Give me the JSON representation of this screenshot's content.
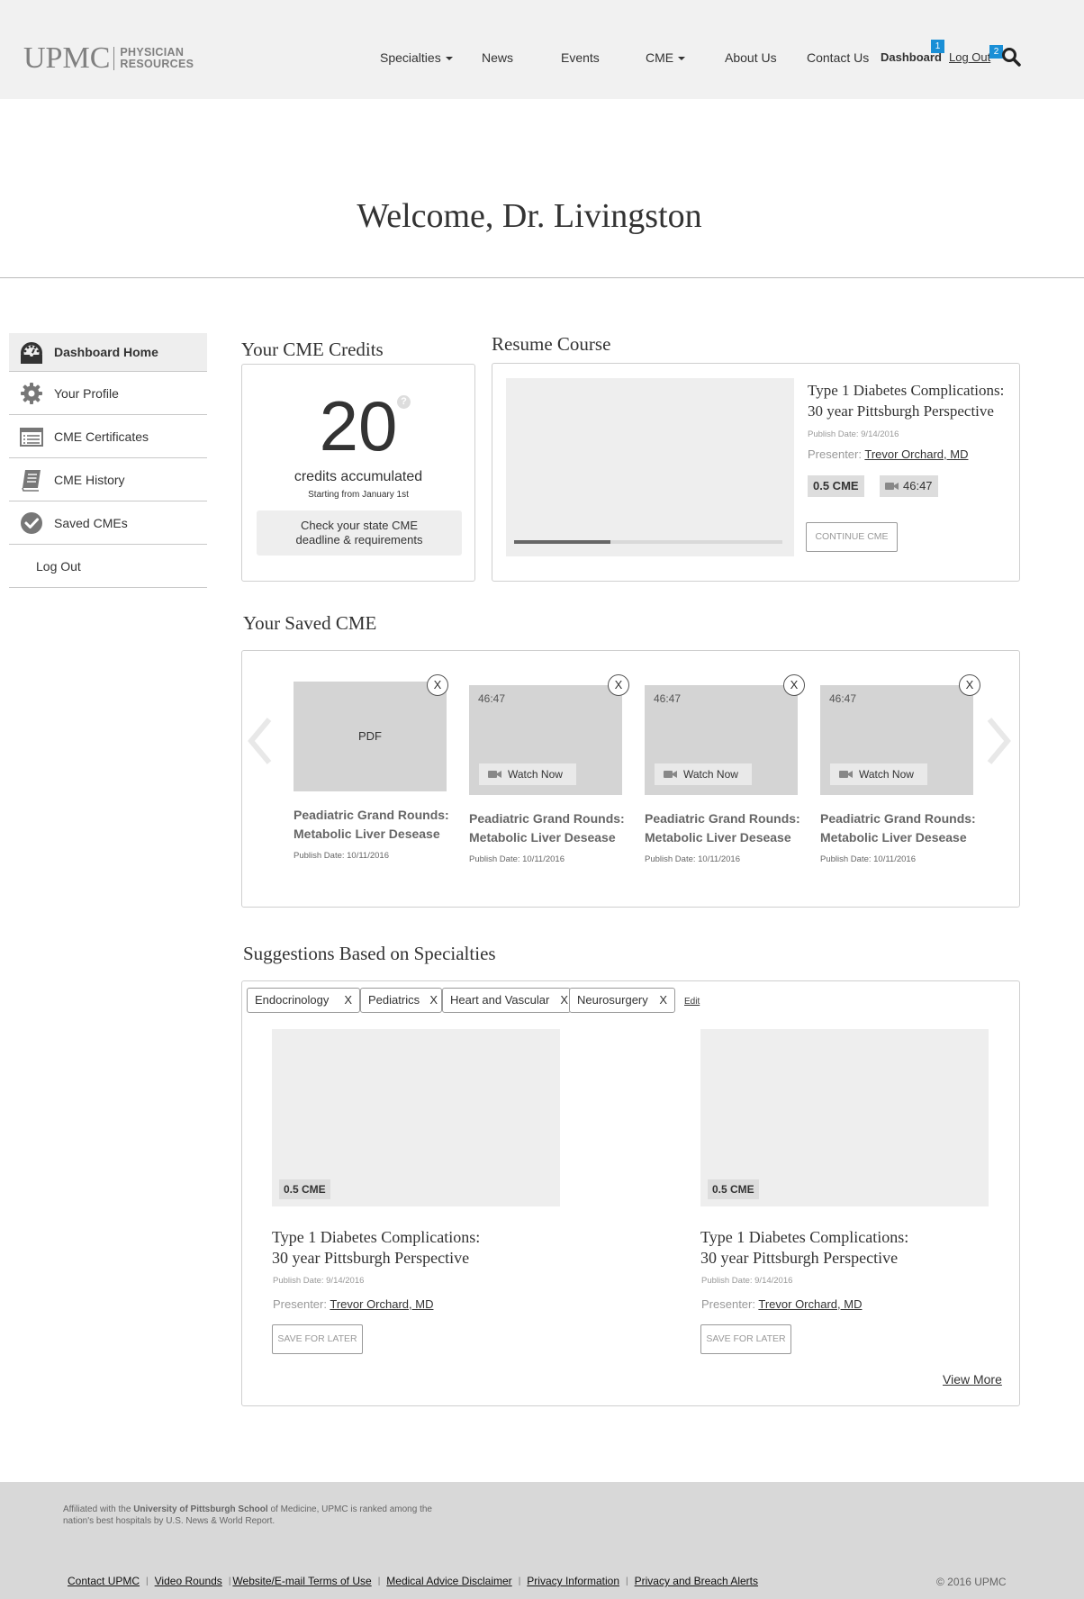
{
  "header": {
    "logo_main": "UPMC",
    "logo_sub_line1": "PHYSICIAN",
    "logo_sub_line2": "RESOURCES",
    "nav": [
      {
        "label": "Specialties"
      },
      {
        "label": "News"
      },
      {
        "label": "Events"
      },
      {
        "label": "CME"
      },
      {
        "label": "About Us"
      },
      {
        "label": "Contact Us"
      },
      {
        "label": "Dashboard",
        "badge": "1"
      },
      {
        "label": "Log Out",
        "badge": "2"
      }
    ]
  },
  "welcome": "Welcome, Dr. Livingston",
  "sidebar": {
    "items": [
      {
        "label": "Dashboard Home",
        "icon": "dashboard-gauge-icon"
      },
      {
        "label": "Your Profile",
        "icon": "gear-icon"
      },
      {
        "label": "CME Certificates",
        "icon": "certificate-list-icon"
      },
      {
        "label": "CME History",
        "icon": "book-icon"
      },
      {
        "label": "Saved CMEs",
        "icon": "checkmark-circle-icon"
      },
      {
        "label": "Log Out"
      }
    ]
  },
  "credits": {
    "title": "Your CME Credits",
    "value": "20",
    "help_glyph": "?",
    "label": "credits accumulated",
    "sub": "Starting from January 1st",
    "check_line1": "Check your state CME",
    "check_line2": "deadline & requirements"
  },
  "resume": {
    "title": "Resume Course",
    "course_line1": "Type 1 Diabetes Complications:",
    "course_line2": "30 year Pittsburgh Perspective",
    "publish_date": "Publish Date: 9/14/2016",
    "presenter_label": "Presenter:",
    "presenter_name": "Trevor Orchard, MD",
    "cme": "0.5 CME",
    "duration": "46:47",
    "progress": 0.36,
    "continue_label": "CONTINUE CME"
  },
  "saved": {
    "title": "Your Saved CME",
    "close_glyph": "X",
    "watch_label": "Watch Now",
    "items": [
      {
        "type": "PDF",
        "title_line1": "Peadiatric Grand Rounds:",
        "title_line2": "Metabolic Liver Desease",
        "date": "Publish Date: 10/11/2016"
      },
      {
        "duration": "46:47",
        "title_line1": "Peadiatric Grand Rounds:",
        "title_line2": "Metabolic Liver Desease",
        "date": "Publish Date: 10/11/2016"
      },
      {
        "duration": "46:47",
        "title_line1": "Peadiatric Grand Rounds:",
        "title_line2": "Metabolic Liver Desease",
        "date": "Publish Date: 10/11/2016"
      },
      {
        "duration": "46:47",
        "title_line1": "Peadiatric Grand Rounds:",
        "title_line2": "Metabolic Liver Desease",
        "date": "Publish Date: 10/11/2016"
      }
    ]
  },
  "suggestions": {
    "title": "Suggestions Based on Specialties",
    "tags": [
      {
        "label": "Endocrinology",
        "x": "X"
      },
      {
        "label": "Pediatrics",
        "x": "X"
      },
      {
        "label": "Heart and Vascular",
        "x": "X"
      },
      {
        "label": "Neurosurgery",
        "x": "X"
      }
    ],
    "edit_label": "Edit",
    "items": [
      {
        "cme": "0.5 CME",
        "title_line1": "Type 1 Diabetes Complications:",
        "title_line2": "30 year Pittsburgh Perspective",
        "date": "Publish Date: 9/14/2016",
        "presenter_label": "Presenter:",
        "presenter_name": "Trevor Orchard, MD",
        "save_label": "SAVE FOR LATER"
      },
      {
        "cme": "0.5 CME",
        "title_line1": "Type 1 Diabetes Complications:",
        "title_line2": "30 year Pittsburgh Perspective",
        "date": "Publish Date: 9/14/2016",
        "presenter_label": "Presenter:",
        "presenter_name": "Trevor Orchard, MD",
        "save_label": "SAVE FOR LATER"
      }
    ],
    "view_more": "View More"
  },
  "footer": {
    "aff_pre": "Affiliated with the ",
    "aff_bold": "University of Pittsburgh School",
    "aff_post": " of Medicine, UPMC is ranked among the nation's best hospitals by U.S. News & World Report.",
    "links": [
      "Contact UPMC",
      "Video Rounds",
      "Website/E-mail Terms of Use",
      "Medical Advice Disclaimer",
      "Privacy Information",
      "Privacy and Breach Alerts"
    ],
    "link_sep": "|",
    "copyright": "© 2016 UPMC"
  },
  "colors": {
    "header_bg": "#f1f1f1",
    "badge": "#1a8fd6",
    "footer_bg": "#d8d8d8"
  }
}
